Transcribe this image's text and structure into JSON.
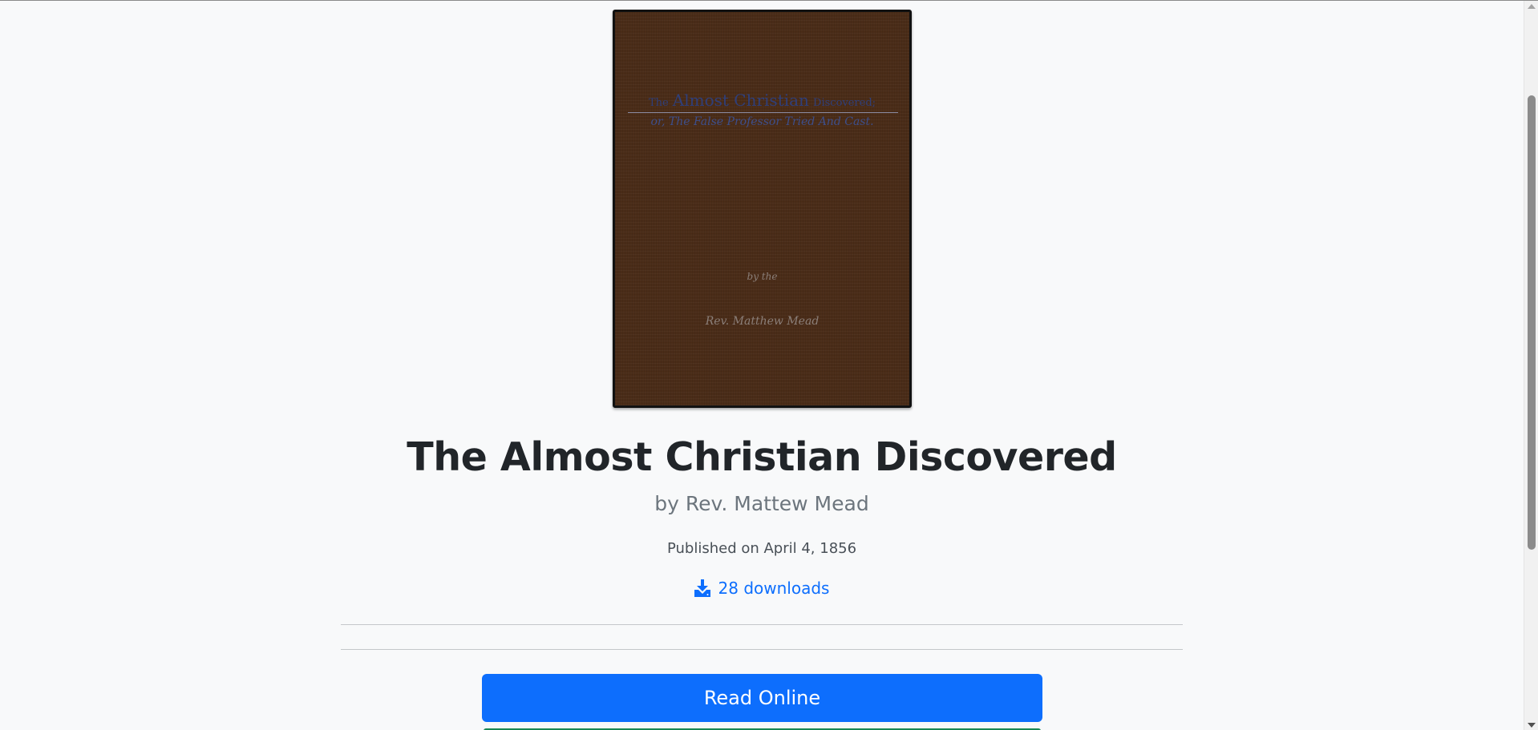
{
  "cover": {
    "title_prefix": "The",
    "title_main": "Almost Christian",
    "title_suffix": "Discovered;",
    "subtitle": "or, The False Professor Tried And Cast.",
    "by": "by the",
    "author": "Rev. Matthew Mead"
  },
  "book": {
    "title": "The Almost Christian Discovered",
    "byline": "by Rev. Mattew Mead",
    "published": "Published on April 4, 1856",
    "downloads": "28 downloads"
  },
  "actions": {
    "read_online": "Read Online"
  },
  "colors": {
    "primary": "#0d6efd",
    "success": "#198754",
    "cover_brown": "#4a2c18"
  },
  "icons": {
    "downloads": "download-icon"
  }
}
